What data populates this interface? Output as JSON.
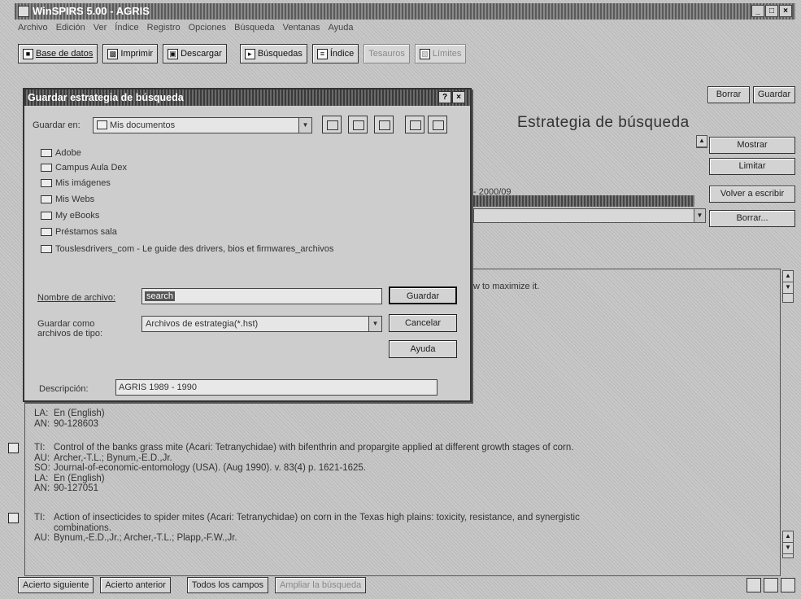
{
  "window": {
    "title": "WinSPIRS 5.00 - AGRIS",
    "controls": [
      "_",
      "□",
      "×"
    ]
  },
  "menubar": [
    "Archivo",
    "Edición",
    "Ver",
    "Índice",
    "Registro",
    "Opciones",
    "Búsqueda",
    "Ventanas",
    "Ayuda"
  ],
  "toolbar": {
    "base_datos": "Base de datos",
    "imprimir": "Imprimir",
    "descargar": "Descargar",
    "busquedas": "Búsquedas",
    "indice": "Índice",
    "tesauros": "Tesauros",
    "limites": "Límites"
  },
  "panel": {
    "title": "Estrategia de búsqueda",
    "btn_borrar_top": "Borrar",
    "btn_guardar_top": "Guardar",
    "mostrar": "Mostrar",
    "limitar": "Limitar",
    "volver": "Volver a escribir",
    "borrar": "Borrar...",
    "date_text": "- 2000/09",
    "snippet": "w to maximize it."
  },
  "records": [
    {
      "TI": "",
      "AU": "",
      "SO": "",
      "LA": "En (English)",
      "AN": "90-128603",
      "marker": false
    },
    {
      "TI": "Control of the banks grass mite (Acari: Tetranychidae) with bifenthrin and propargite applied at different growth stages of corn.",
      "AU": "Archer,-T.L.; Bynum,-E.D.,Jr.",
      "SO": "Journal-of-economic-entomology (USA). (Aug 1990). v. 83(4) p. 1621-1625.",
      "LA": "En (English)",
      "AN": "90-127051",
      "marker": true
    },
    {
      "TI": "Action of insecticides to spider mites (Acari: Tetranychidae) on corn in the Texas high plains: toxicity, resistance, and synergistic",
      "TI2": "combinations.",
      "AU": "Bynum,-E.D.,Jr.; Archer,-T.L.; Plapp,-F.W.,Jr.",
      "marker": true
    }
  ],
  "bottombar": {
    "siguiente": "Acierto siguiente",
    "anterior": "Acierto anterior",
    "todos": "Todos los campos",
    "ampliar": "Ampliar la búsqueda"
  },
  "dialog": {
    "title": "Guardar estrategia de búsqueda",
    "help_btn": "?",
    "close_btn": "×",
    "guardar_en_label": "Guardar en:",
    "guardar_en_value": "Mis documentos",
    "folders": [
      "Adobe",
      "Campus Aula Dex",
      "Mis imágenes",
      "Mis Webs",
      "My eBooks",
      "Préstamos sala",
      "Touslesdrivers_com - Le guide des drivers, bios et firmwares_archivos"
    ],
    "nombre_label": "Nombre de archivo:",
    "nombre_value": "search",
    "tipo_label_1": "Guardar como",
    "tipo_label_2": "archivos de tipo:",
    "tipo_value": "Archivos de estrategia(*.hst)",
    "descripcion_label": "Descripción:",
    "descripcion_value": "AGRIS 1989 - 1990",
    "btn_guardar": "Guardar",
    "btn_cancelar": "Cancelar",
    "btn_ayuda": "Ayuda"
  }
}
